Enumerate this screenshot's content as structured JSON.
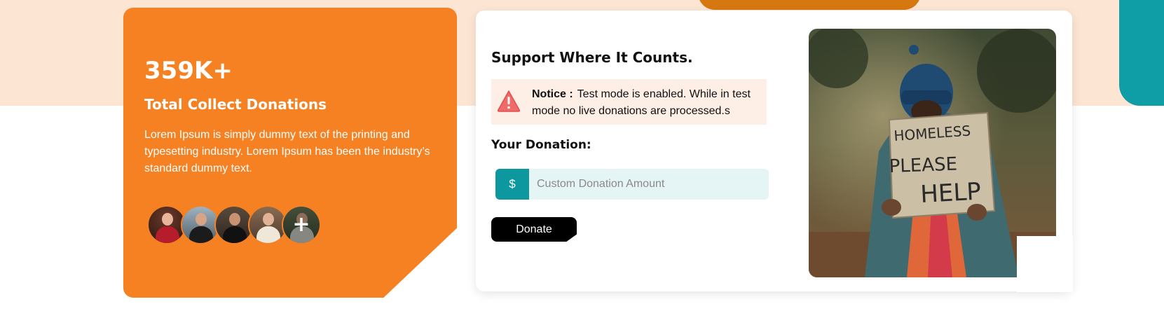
{
  "stats": {
    "number": "359K+",
    "title": "Total Collect Donations",
    "description": "Lorem Ipsum is simply dummy text of the printing and typesetting industry. Lorem Ipsum has been the industry’s standard dummy text.",
    "more_symbol": "+"
  },
  "donation": {
    "title": "Support Where It Counts.",
    "notice_label": "Notice :",
    "notice_text": "Test mode is enabled. While in test mode no live donations are processed.s",
    "your_donation_label": "Your Donation:",
    "currency_symbol": "$",
    "amount_placeholder": "Custom Donation Amount",
    "amount_value": "",
    "donate_button": "Donate"
  },
  "photo_sign": {
    "line1": "HOMELESS",
    "line2": "PLEASE",
    "line3": "HELP"
  },
  "colors": {
    "accent_orange": "#f58123",
    "accent_teal": "#0d98a0",
    "band_peach": "#fde5d4"
  },
  "icons": {
    "notice_icon": "warning-triangle-icon"
  }
}
